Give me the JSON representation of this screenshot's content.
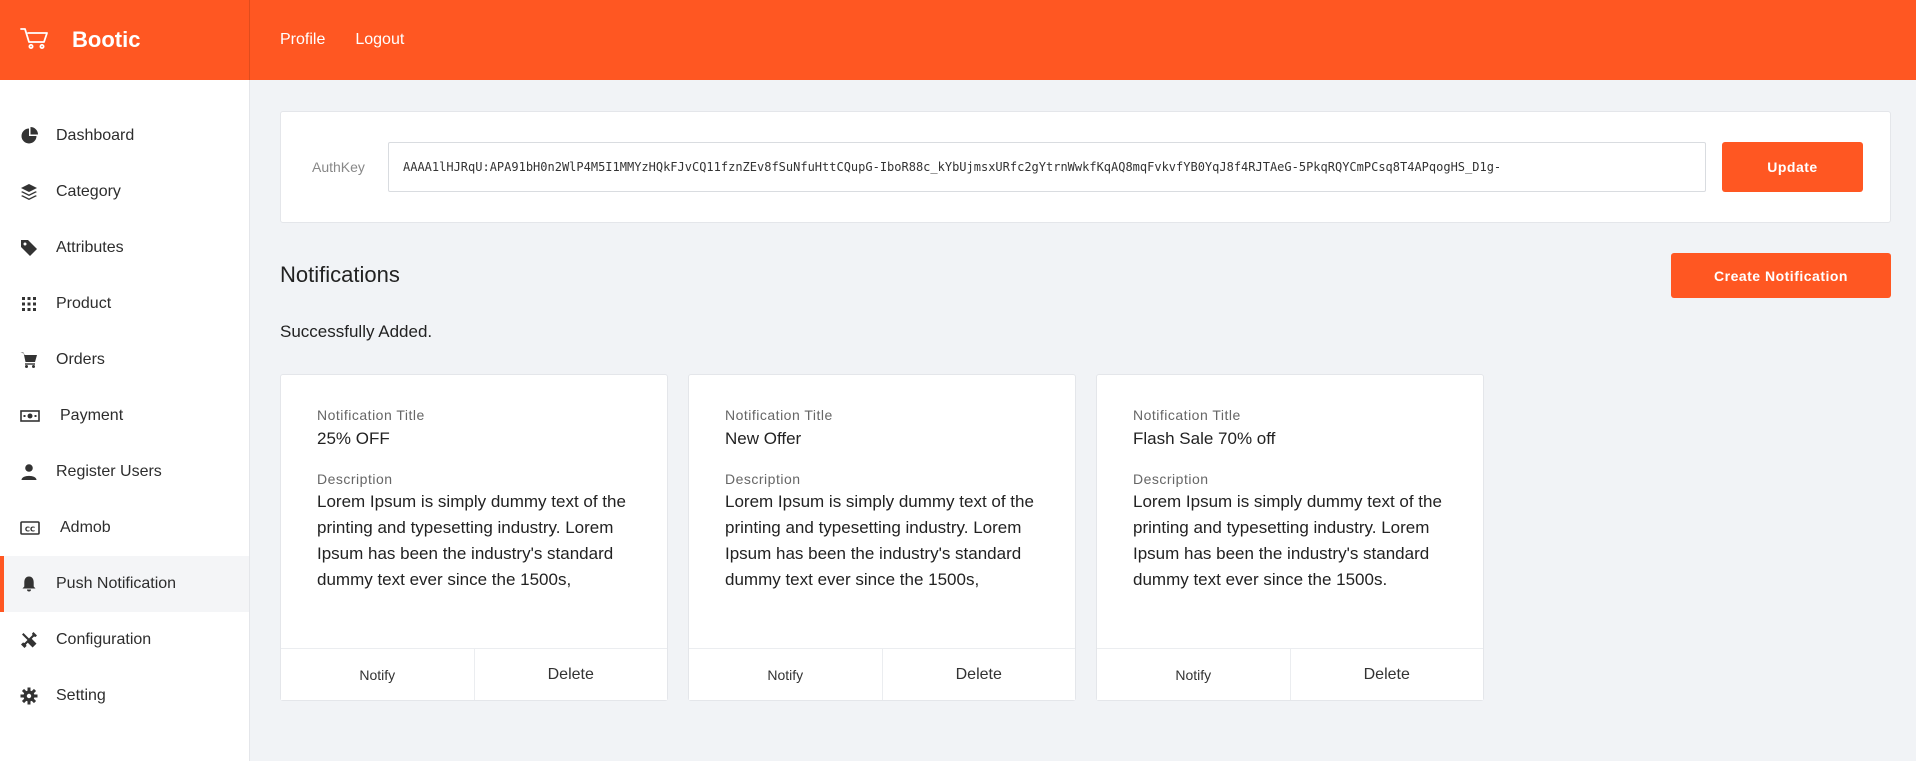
{
  "brand": {
    "name": "Bootic",
    "accent": "#ff5722"
  },
  "topnav": [
    {
      "label": "Profile"
    },
    {
      "label": "Logout"
    }
  ],
  "sidebar": {
    "items": [
      {
        "label": "Dashboard",
        "icon": "pie-chart-icon"
      },
      {
        "label": "Category",
        "icon": "layers-icon"
      },
      {
        "label": "Attributes",
        "icon": "tag-icon"
      },
      {
        "label": "Product",
        "icon": "grid-icon"
      },
      {
        "label": "Orders",
        "icon": "cart-icon"
      },
      {
        "label": "Payment",
        "icon": "money-icon"
      },
      {
        "label": "Register Users",
        "icon": "user-icon"
      },
      {
        "label": "Admob",
        "icon": "cc-icon"
      },
      {
        "label": "Push Notification",
        "icon": "bell-icon",
        "active": true
      },
      {
        "label": "Configuration",
        "icon": "tools-icon"
      },
      {
        "label": "Setting",
        "icon": "gear-icon"
      }
    ]
  },
  "auth": {
    "label": "AuthKey",
    "value": "AAAA1lHJRqU:APA91bH0n2WlP4M5I1MMYzHQkFJvCQ11fznZEv8fSuNfuHttCQupG-IboR88c_kYbUjmsxURfc2gYtrnWwkfKqAQ8mqFvkvfYB0YqJ8f4RJTAeG-5PkqRQYCmPCsq8T4APqogHS_D1g-",
    "update_label": "Update"
  },
  "notifications": {
    "title": "Notifications",
    "create_label": "Create Notification",
    "message": "Successfully Added.",
    "title_label": "Notification Title",
    "description_label": "Description",
    "notify_label": "Notify",
    "delete_label": "Delete",
    "cards": [
      {
        "title": "25% OFF",
        "description": "Lorem Ipsum is simply dummy text of the printing and typesetting industry. Lorem Ipsum has been the industry's standard dummy text ever since the 1500s,"
      },
      {
        "title": "New Offer",
        "description": "Lorem Ipsum is simply dummy text of the printing and typesetting industry. Lorem Ipsum has been the industry's standard dummy text ever since the 1500s,"
      },
      {
        "title": "Flash Sale 70% off",
        "description": "Lorem Ipsum is simply dummy text of the printing and typesetting industry. Lorem Ipsum has been the industry's standard dummy text ever since the 1500s."
      }
    ]
  }
}
